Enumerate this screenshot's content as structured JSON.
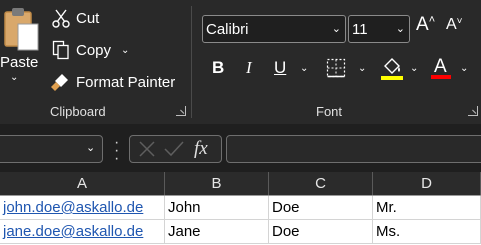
{
  "clipboard": {
    "paste_label": "Paste",
    "cut_label": "Cut",
    "copy_label": "Copy",
    "format_painter_label": "Format Painter",
    "group_label": "Clipboard"
  },
  "font": {
    "name_value": "Calibri",
    "size_value": "11",
    "bold_label": "B",
    "italic_label": "I",
    "underline_label": "U",
    "grow_label": "A",
    "shrink_label": "A",
    "group_label": "Font",
    "highlight_color": "#ffff00",
    "font_color": "#ff0000"
  },
  "formula_bar": {
    "fx_label": "fx"
  },
  "columns": [
    "A",
    "B",
    "C",
    "D"
  ],
  "rows": [
    [
      "john.doe@askallo.de",
      "John",
      "Doe",
      "Mr."
    ],
    [
      "jane.doe@askallo.de",
      "Jane",
      "Doe",
      "Ms."
    ]
  ]
}
